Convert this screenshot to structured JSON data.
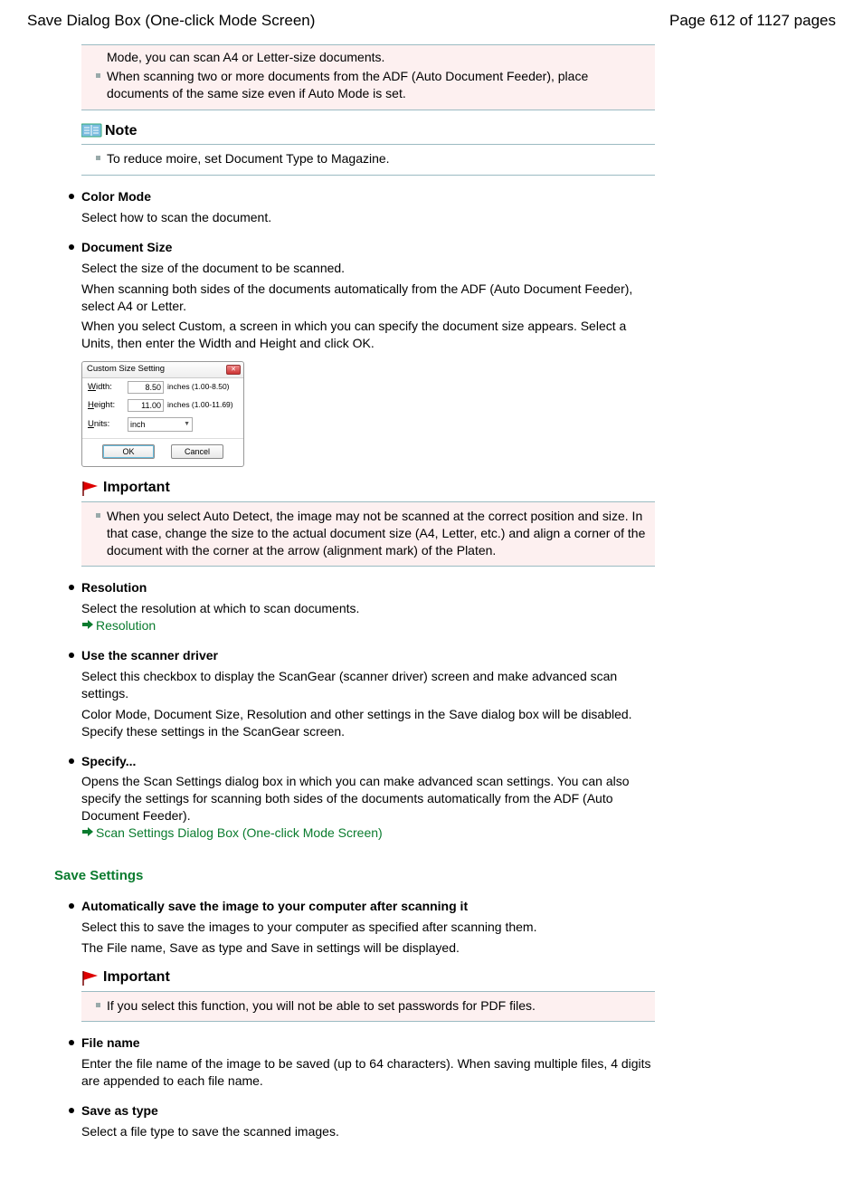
{
  "header": {
    "title": "Save Dialog Box (One-click Mode Screen)",
    "page": "Page 612 of 1127 pages"
  },
  "top_box": {
    "line1": "Mode, you can scan A4 or Letter-size documents.",
    "line2": "When scanning two or more documents from the ADF (Auto Document Feeder), place documents of the same size even if Auto Mode is set."
  },
  "note": {
    "title": "Note",
    "body": "To reduce moire, set Document Type to Magazine."
  },
  "color_mode": {
    "title": "Color Mode",
    "body": "Select how to scan the document."
  },
  "doc_size": {
    "title": "Document Size",
    "p1": "Select the size of the document to be scanned.",
    "p2": "When scanning both sides of the documents automatically from the ADF (Auto Document Feeder), select A4 or Letter.",
    "p3": "When you select Custom, a screen in which you can specify the document size appears. Select a Units, then enter the Width and Height and click OK."
  },
  "css_dialog": {
    "title": "Custom Size Setting",
    "width_l": "Width:",
    "width_v": "8.50",
    "width_h": "inches (1.00-8.50)",
    "height_l": "Height:",
    "height_v": "11.00",
    "height_h": "inches (1.00-11.69)",
    "units_l": "Units:",
    "units_v": "inch",
    "ok": "OK",
    "cancel": "Cancel"
  },
  "important1": {
    "title": "Important",
    "body": "When you select Auto Detect, the image may not be scanned at the correct position and size. In that case, change the size to the actual document size (A4, Letter, etc.) and align a corner of the document with the corner at the arrow (alignment mark) of the Platen."
  },
  "resolution": {
    "title": "Resolution",
    "body": "Select the resolution at which to scan documents.",
    "link": "Resolution"
  },
  "use_driver": {
    "title": "Use the scanner driver",
    "p1": "Select this checkbox to display the ScanGear (scanner driver) screen and make advanced scan settings.",
    "p2": "Color Mode, Document Size, Resolution and other settings in the Save dialog box will be disabled. Specify these settings in the ScanGear screen."
  },
  "specify": {
    "title": "Specify...",
    "body": "Opens the Scan Settings dialog box in which you can make advanced scan settings. You can also specify the settings for scanning both sides of the documents automatically from the ADF (Auto Document Feeder).",
    "link": "Scan Settings Dialog Box (One-click Mode Screen)"
  },
  "save_settings": {
    "title": "Save Settings"
  },
  "auto_save": {
    "title": "Automatically save the image to your computer after scanning it",
    "p1": "Select this to save the images to your computer as specified after scanning them.",
    "p2": "The File name, Save as type and Save in settings will be displayed."
  },
  "important2": {
    "title": "Important",
    "body": "If you select this function, you will not be able to set passwords for PDF files."
  },
  "file_name": {
    "title": "File name",
    "body": "Enter the file name of the image to be saved (up to 64 characters). When saving multiple files, 4 digits are appended to each file name."
  },
  "save_as": {
    "title": "Save as type",
    "body": "Select a file type to save the scanned images."
  }
}
